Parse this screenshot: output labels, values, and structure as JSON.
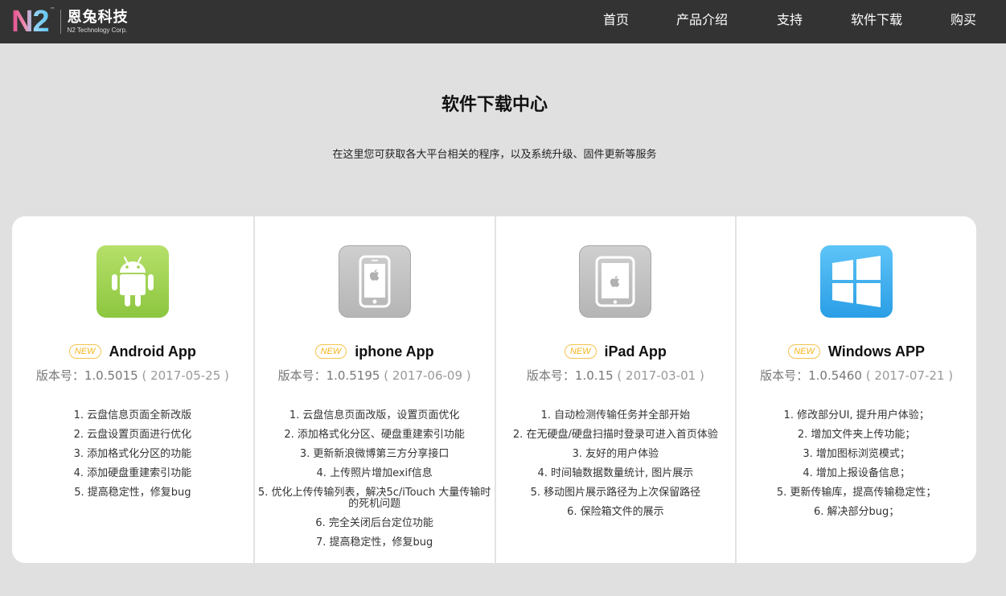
{
  "brand": {
    "logo": "N2",
    "tm": "™",
    "name_cn": "恩兔科技",
    "name_en": "N2 Technology Corp."
  },
  "nav": [
    "首页",
    "产品介绍",
    "支持",
    "软件下载",
    "购买"
  ],
  "page": {
    "title": "软件下载中心",
    "subtitle": "在这里您可获取各大平台相关的程序，以及系统升级、固件更新等服务"
  },
  "apps": [
    {
      "icon": "android-icon",
      "badge": "NEW",
      "name": "Android App",
      "version_prefix": "版本号：1.0.5015",
      "date": "( 2017-05-25 )",
      "changes": [
        "1. 云盘信息页面全新改版",
        "2. 云盘设置页面进行优化",
        "3. 添加格式化分区的功能",
        "4. 添加硬盘重建索引功能",
        "5. 提高稳定性，修复bug"
      ]
    },
    {
      "icon": "iphone-icon",
      "badge": "NEW",
      "name": "iphone App",
      "version_prefix": "版本号：1.0.5195",
      "date": "( 2017-06-09 )",
      "changes": [
        "1. 云盘信息页面改版，设置页面优化",
        "2. 添加格式化分区、硬盘重建索引功能",
        "3. 更新新浪微博第三方分享接口",
        "4. 上传照片增加exif信息",
        "5. 优化上传传输列表，解决5c/iTouch 大量传输时的死机问题",
        "6. 完全关闭后台定位功能",
        "7. 提高稳定性，修复bug"
      ]
    },
    {
      "icon": "ipad-icon",
      "badge": "NEW",
      "name": "iPad App",
      "version_prefix": "版本号：1.0.15",
      "date": "( 2017-03-01 )",
      "changes": [
        "1. 自动检测传输任务并全部开始",
        "2. 在无硬盘/硬盘扫描时登录可进入首页体验",
        "3. 友好的用户体验",
        "4. 时间轴数据数量统计, 图片展示",
        "5. 移动图片展示路径为上次保留路径",
        "6. 保险箱文件的展示"
      ]
    },
    {
      "icon": "windows-icon",
      "badge": "NEW",
      "name": "Windows APP",
      "version_prefix": "版本号：1.0.5460",
      "date": "( 2017-07-21 )",
      "changes": [
        "1. 修改部分UI, 提升用户体验；",
        "2. 增加文件夹上传功能；",
        "3. 增加图标浏览模式；",
        "4. 增加上报设备信息；",
        "5. 更新传输库，提高传输稳定性；",
        "6. 解决部分bug；"
      ]
    }
  ],
  "colors": {
    "header_bg": "#333333",
    "page_bg": "#e0e0e0",
    "badge": "#f5b31b",
    "android": "#8cc63f",
    "windows": "#2a9ee6"
  }
}
